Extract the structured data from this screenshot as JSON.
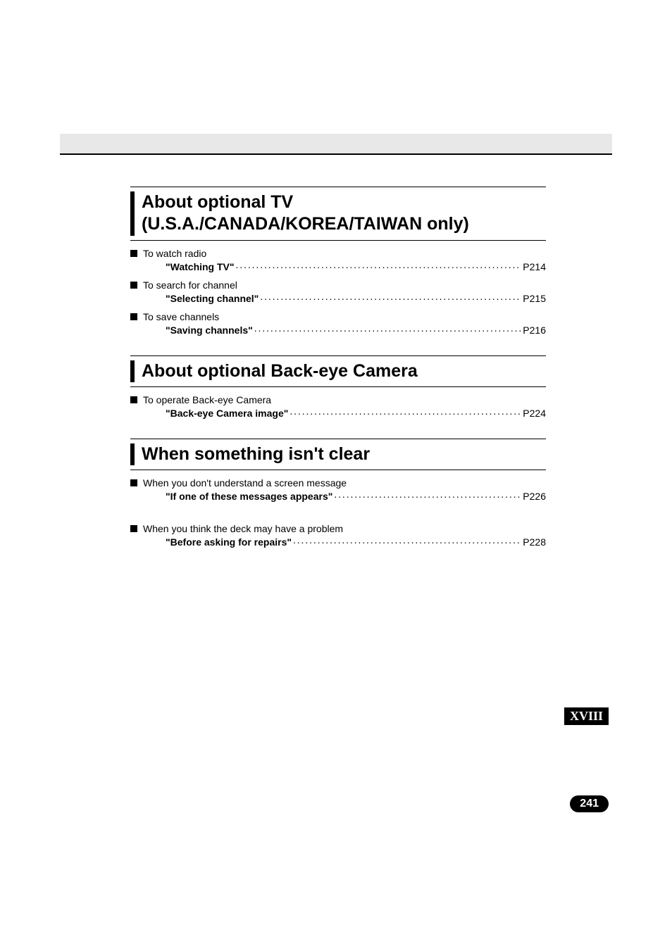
{
  "sections": [
    {
      "title": "About optional TV (U.S.A./CANADA/KOREA/TAIWAN only)",
      "entries": [
        {
          "label": "To watch radio",
          "link_title": "\"Watching TV\"",
          "page": "P214"
        },
        {
          "label": "To search for channel",
          "link_title": "\"Selecting channel\"",
          "page": "P215"
        },
        {
          "label": "To save channels",
          "link_title": "\"Saving channels\"",
          "page": "P216"
        }
      ]
    },
    {
      "title": "About optional Back-eye Camera",
      "entries": [
        {
          "label": "To operate Back-eye Camera",
          "link_title": "\"Back-eye Camera image\"",
          "page": "P224"
        }
      ]
    },
    {
      "title": "When something isn't clear",
      "entries": [
        {
          "label": "When you don't understand a screen message",
          "link_title": "\"If one of these messages appears\"",
          "page": "P226"
        },
        {
          "label": "When you think the deck may have a problem",
          "link_title": "\"Before asking for repairs\"",
          "page": "P228"
        }
      ]
    }
  ],
  "side_tab": "XVIII",
  "page_number": "241"
}
